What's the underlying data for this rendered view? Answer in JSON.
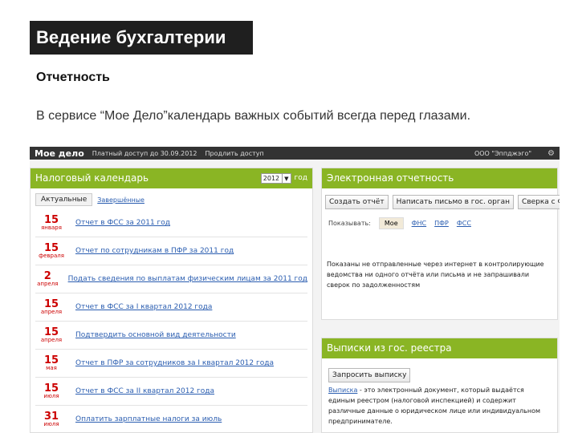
{
  "slide": {
    "title": "Ведение бухгалтерии",
    "subtitle": "Отчетность",
    "description": "В сервисе “Мое Дело”календарь важных событий всегда перед глазами."
  },
  "app": {
    "logo": "Мое дело",
    "access_info": "Платный доступ до 30.09.2012",
    "extend_link": "Продлить доступ",
    "org": "ООО \"Эппджэго\"",
    "gear_icon": "gear-icon"
  },
  "calendar": {
    "title": "Налоговый календарь",
    "year": "2012",
    "year_suffix": "год",
    "tab_active": "Актуальные",
    "tab_done": "Завершённые",
    "events": [
      {
        "day": "15",
        "month": "января",
        "text": "Отчет в ФСС за 2011 год"
      },
      {
        "day": "15",
        "month": "февраля",
        "text": "Отчет по сотрудникам в ПФР за 2011 год"
      },
      {
        "day": "2",
        "month": "апреля",
        "text": "Подать сведения по выплатам физическим лицам за 2011 год"
      },
      {
        "day": "15",
        "month": "апреля",
        "text": "Отчет в ФСС за I квартал 2012 года"
      },
      {
        "day": "15",
        "month": "апреля",
        "text": "Подтвердить основной вид деятельности"
      },
      {
        "day": "15",
        "month": "мая",
        "text": "Отчет в ПФР за сотрудников за I квартал 2012 года"
      },
      {
        "day": "15",
        "month": "июля",
        "text": "Отчет в ФСС за II квартал 2012 года"
      },
      {
        "day": "31",
        "month": "июля",
        "text": "Оплатить зарплатные налоги за июль"
      }
    ]
  },
  "reporting": {
    "title": "Электронная отчетность",
    "buttons": [
      "Создать отчёт",
      "Написать письмо в гос. орган",
      "Сверка с ФНС"
    ],
    "show_label": "Показывать:",
    "filters": [
      "Мое",
      "ФНС",
      "ПФР",
      "ФСС"
    ],
    "text": "Показаны не отправленные через интернет в контролирующие ведомства ни одного отчёта или письма и не запрашивали сверок по задолженностям"
  },
  "extract": {
    "title": "Выписки из гос. реестра",
    "button": "Запросить выписку",
    "link": "Выписка",
    "text": " - это электронный документ, который выдаётся единым реестром (налоговой инспекцией) и содержит различные данные о юридическом лице или индивидуальном предпринимателе."
  }
}
